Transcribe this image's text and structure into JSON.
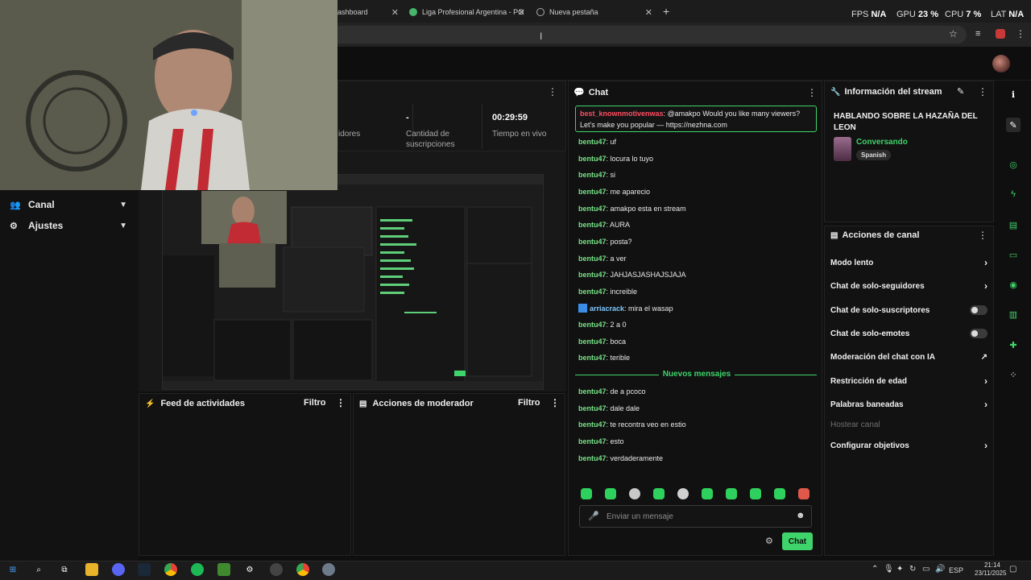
{
  "browser": {
    "tabs": [
      {
        "label": "ashboard"
      },
      {
        "label": "Liga Profesional Argentina - PO"
      },
      {
        "label": "Nueva pestaña"
      }
    ],
    "new_tab_icon": "plus",
    "perf": {
      "fps_label": "FPS",
      "fps_value": "N/A",
      "gpu_label": "GPU",
      "gpu_value": "23 %",
      "cpu_label": "CPU",
      "cpu_value": "7 %",
      "lat_label": "LAT",
      "lat_value": "N/A"
    }
  },
  "sidebar": {
    "items": [
      {
        "label": "Canal",
        "icon": "users-icon"
      },
      {
        "label": "Ajustes",
        "icon": "gear-icon"
      }
    ]
  },
  "stats": {
    "partial_label": "idores",
    "subs_value": "-",
    "subs_label_1": "Cantidad de",
    "subs_label_2": "suscripciones",
    "time_value": "00:29:59",
    "time_label": "Tiempo en vivo"
  },
  "panels": {
    "activity_feed": {
      "title": "Feed de actividades",
      "filter": "Filtro"
    },
    "mod_actions": {
      "title": "Acciones de moderador",
      "filter": "Filtro"
    }
  },
  "chat": {
    "title": "Chat",
    "pinned": {
      "user": "best_knownmotivenwas",
      "text_1": ": @amakpo Would you like many viewers?",
      "text_2": "Let's make you popular — https://nezhna.com"
    },
    "messages": [
      {
        "user": "bentu47",
        "text": ": uf"
      },
      {
        "user": "bentu47",
        "text": ": locura lo tuyo"
      },
      {
        "user": "bentu47",
        "text": ": si"
      },
      {
        "user": "bentu47",
        "text": ": me aparecio"
      },
      {
        "user": "bentu47",
        "text": ": amakpo esta en stream"
      },
      {
        "user": "bentu47",
        "text": ": AURA"
      },
      {
        "user": "bentu47",
        "text": ": posta?"
      },
      {
        "user": "bentu47",
        "text": ": a ver"
      },
      {
        "user": "bentu47",
        "text": ": JAHJASJASHAJSJAJA"
      },
      {
        "user": "bentu47",
        "text": ": increible"
      },
      {
        "user": "arriacrack",
        "text": ": mira el wasap"
      },
      {
        "user": "bentu47",
        "text": ": 2 a 0"
      },
      {
        "user": "bentu47",
        "text": ": boca"
      },
      {
        "user": "bentu47",
        "text": ": terible"
      }
    ],
    "new_messages_label": "Nuevos mensajes",
    "new_messages": [
      {
        "user": "bentu47",
        "text": ": de a pcoco"
      },
      {
        "user": "bentu47",
        "text": ": dale dale"
      },
      {
        "user": "bentu47",
        "text": ": te recontra veo en estio"
      },
      {
        "user": "bentu47",
        "text": ": esto"
      },
      {
        "user": "bentu47",
        "text": ": verdaderamente"
      }
    ],
    "input_placeholder": "Enviar un mensaje",
    "send_label": "Chat"
  },
  "stream_info": {
    "title": "Información del stream",
    "stream_title": "HABLANDO SOBRE LA HAZAÑA DEL LEON",
    "category": "Conversando",
    "language": "Spanish"
  },
  "channel_actions": {
    "title": "Acciones de canal",
    "items": [
      {
        "label": "Modo lento",
        "control": "chevron"
      },
      {
        "label": "Chat de solo-seguidores",
        "control": "chevron"
      },
      {
        "label": "Chat de solo-suscriptores",
        "control": "toggle"
      },
      {
        "label": "Chat de solo-emotes",
        "control": "toggle"
      },
      {
        "label": "Moderación del chat con IA",
        "control": "external"
      },
      {
        "label": "Restricción de edad",
        "control": "chevron"
      },
      {
        "label": "Palabras baneadas",
        "control": "chevron"
      },
      {
        "label": "Hostear canal",
        "control": "disabled"
      },
      {
        "label": "Configurar objetivos",
        "control": "chevron"
      }
    ]
  },
  "taskbar": {
    "lang": "ESP",
    "time": "21:14",
    "date": "23/11/2025"
  },
  "colors": {
    "accent": "#3fd36b",
    "username": "#78e388",
    "pinned_user": "#ff4f62"
  }
}
